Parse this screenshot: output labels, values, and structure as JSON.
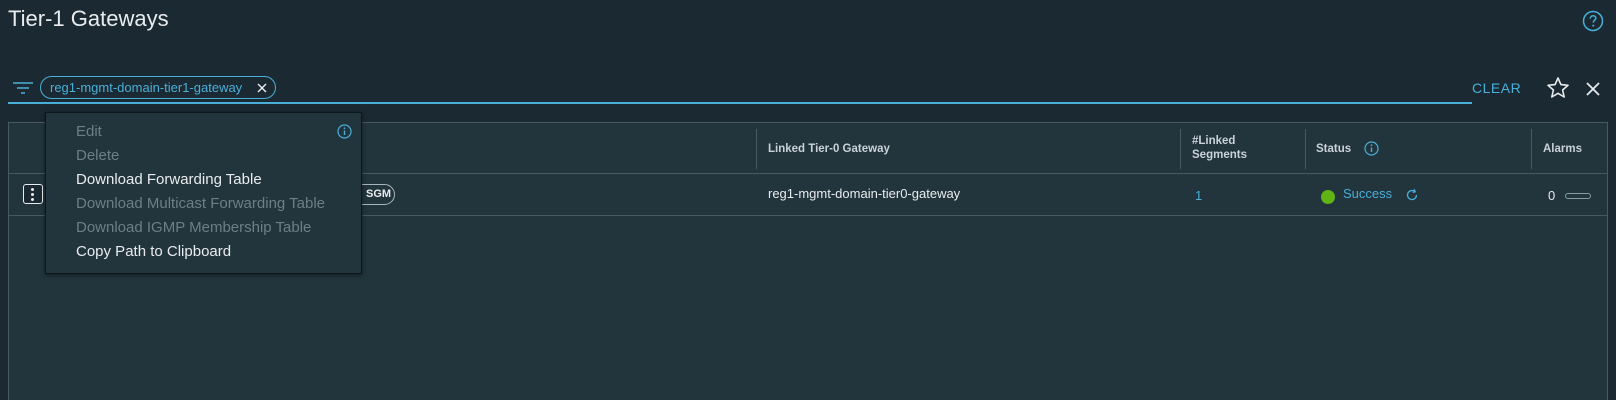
{
  "page": {
    "title": "Tier-1 Gateways"
  },
  "filter": {
    "chip_label": "reg1-mgmt-domain-tier1-gateway",
    "clear_label": "CLEAR"
  },
  "grid": {
    "columns": {
      "linked_tier0": "Linked Tier-0 Gateway",
      "linked_segments_line1": "#Linked",
      "linked_segments_line2": "Segments",
      "status": "Status",
      "alarms": "Alarms"
    },
    "rows": [
      {
        "tag": "SGM",
        "linked_tier0": "reg1-mgmt-domain-tier0-gateway",
        "linked_segments": "1",
        "status": "Success",
        "status_color": "#60b515",
        "alarms": "0"
      }
    ]
  },
  "context_menu": {
    "items": [
      {
        "label": "Edit",
        "enabled": false
      },
      {
        "label": "Delete",
        "enabled": false
      },
      {
        "label": "Download Forwarding Table",
        "enabled": true
      },
      {
        "label": "Download Multicast Forwarding Table",
        "enabled": false
      },
      {
        "label": "Download IGMP Membership Table",
        "enabled": false
      },
      {
        "label": "Copy Path to Clipboard",
        "enabled": true
      }
    ]
  },
  "colors": {
    "background": "#1b2a32",
    "accent": "#49afd9",
    "success": "#60b515",
    "disabled_text": "#6e7e88"
  },
  "icons": [
    "help-icon",
    "filter-icon",
    "chip-close-icon",
    "star-icon",
    "close-icon",
    "kebab-icon",
    "info-icon",
    "refresh-icon"
  ]
}
